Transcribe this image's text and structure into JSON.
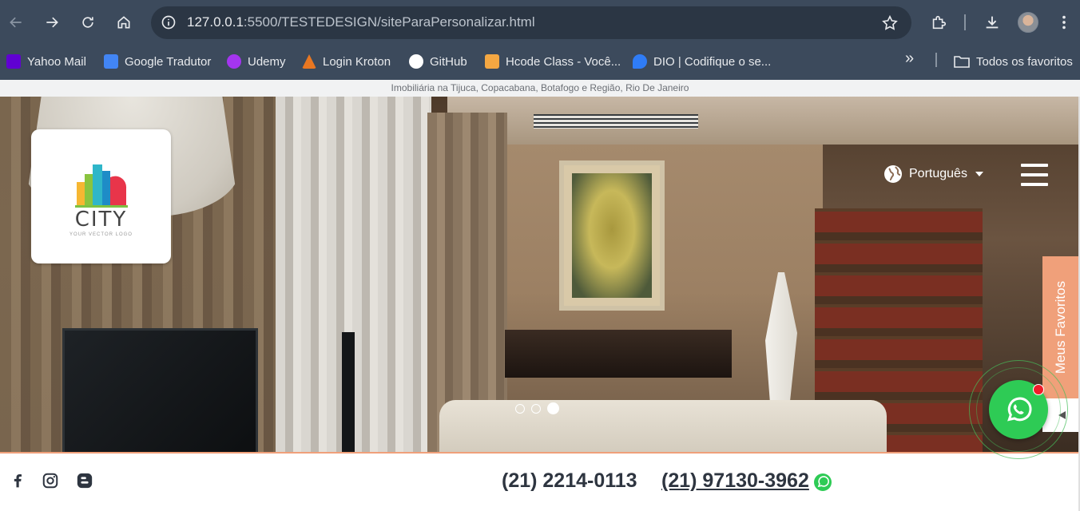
{
  "browser": {
    "url_host": "127.0.0.1",
    "url_rest": ":5500/TESTEDESIGN/siteParaPersonalizar.html",
    "bookmarks": [
      {
        "label": "Yahoo Mail",
        "icon": "yahoo-mail-icon",
        "color": "#6001d2"
      },
      {
        "label": "Google Tradutor",
        "icon": "google-translate-icon",
        "color": "#4285f4"
      },
      {
        "label": "Udemy",
        "icon": "udemy-icon",
        "color": "#a435f0"
      },
      {
        "label": "Login Kroton",
        "icon": "kroton-icon",
        "color": "#e87722"
      },
      {
        "label": "GitHub",
        "icon": "github-icon",
        "color": "#ffffff"
      },
      {
        "label": "Hcode Class - Você...",
        "icon": "hcode-icon",
        "color": "#f4a742"
      },
      {
        "label": "DIO | Codifique o se...",
        "icon": "dio-icon",
        "color": "#2f7cf6"
      }
    ],
    "all_favorites": "Todos os favoritos"
  },
  "page": {
    "topbar_text": "Imobiliária na Tijuca, Copacabana, Botafogo e Região, Rio De Janeiro",
    "logo": {
      "brand": "CITY",
      "tagline": "YOUR VECTOR LOGO"
    },
    "language": "Português",
    "carousel": {
      "slides": 3,
      "active_index": 2
    },
    "favorites_tab": "Meus Favoritos",
    "phones": [
      "(21) 2214-0113",
      "(21) 97130-3962"
    ],
    "colors": {
      "accent": "#f0a07a",
      "whatsapp": "#2ecb55",
      "text": "#2e3540"
    }
  }
}
